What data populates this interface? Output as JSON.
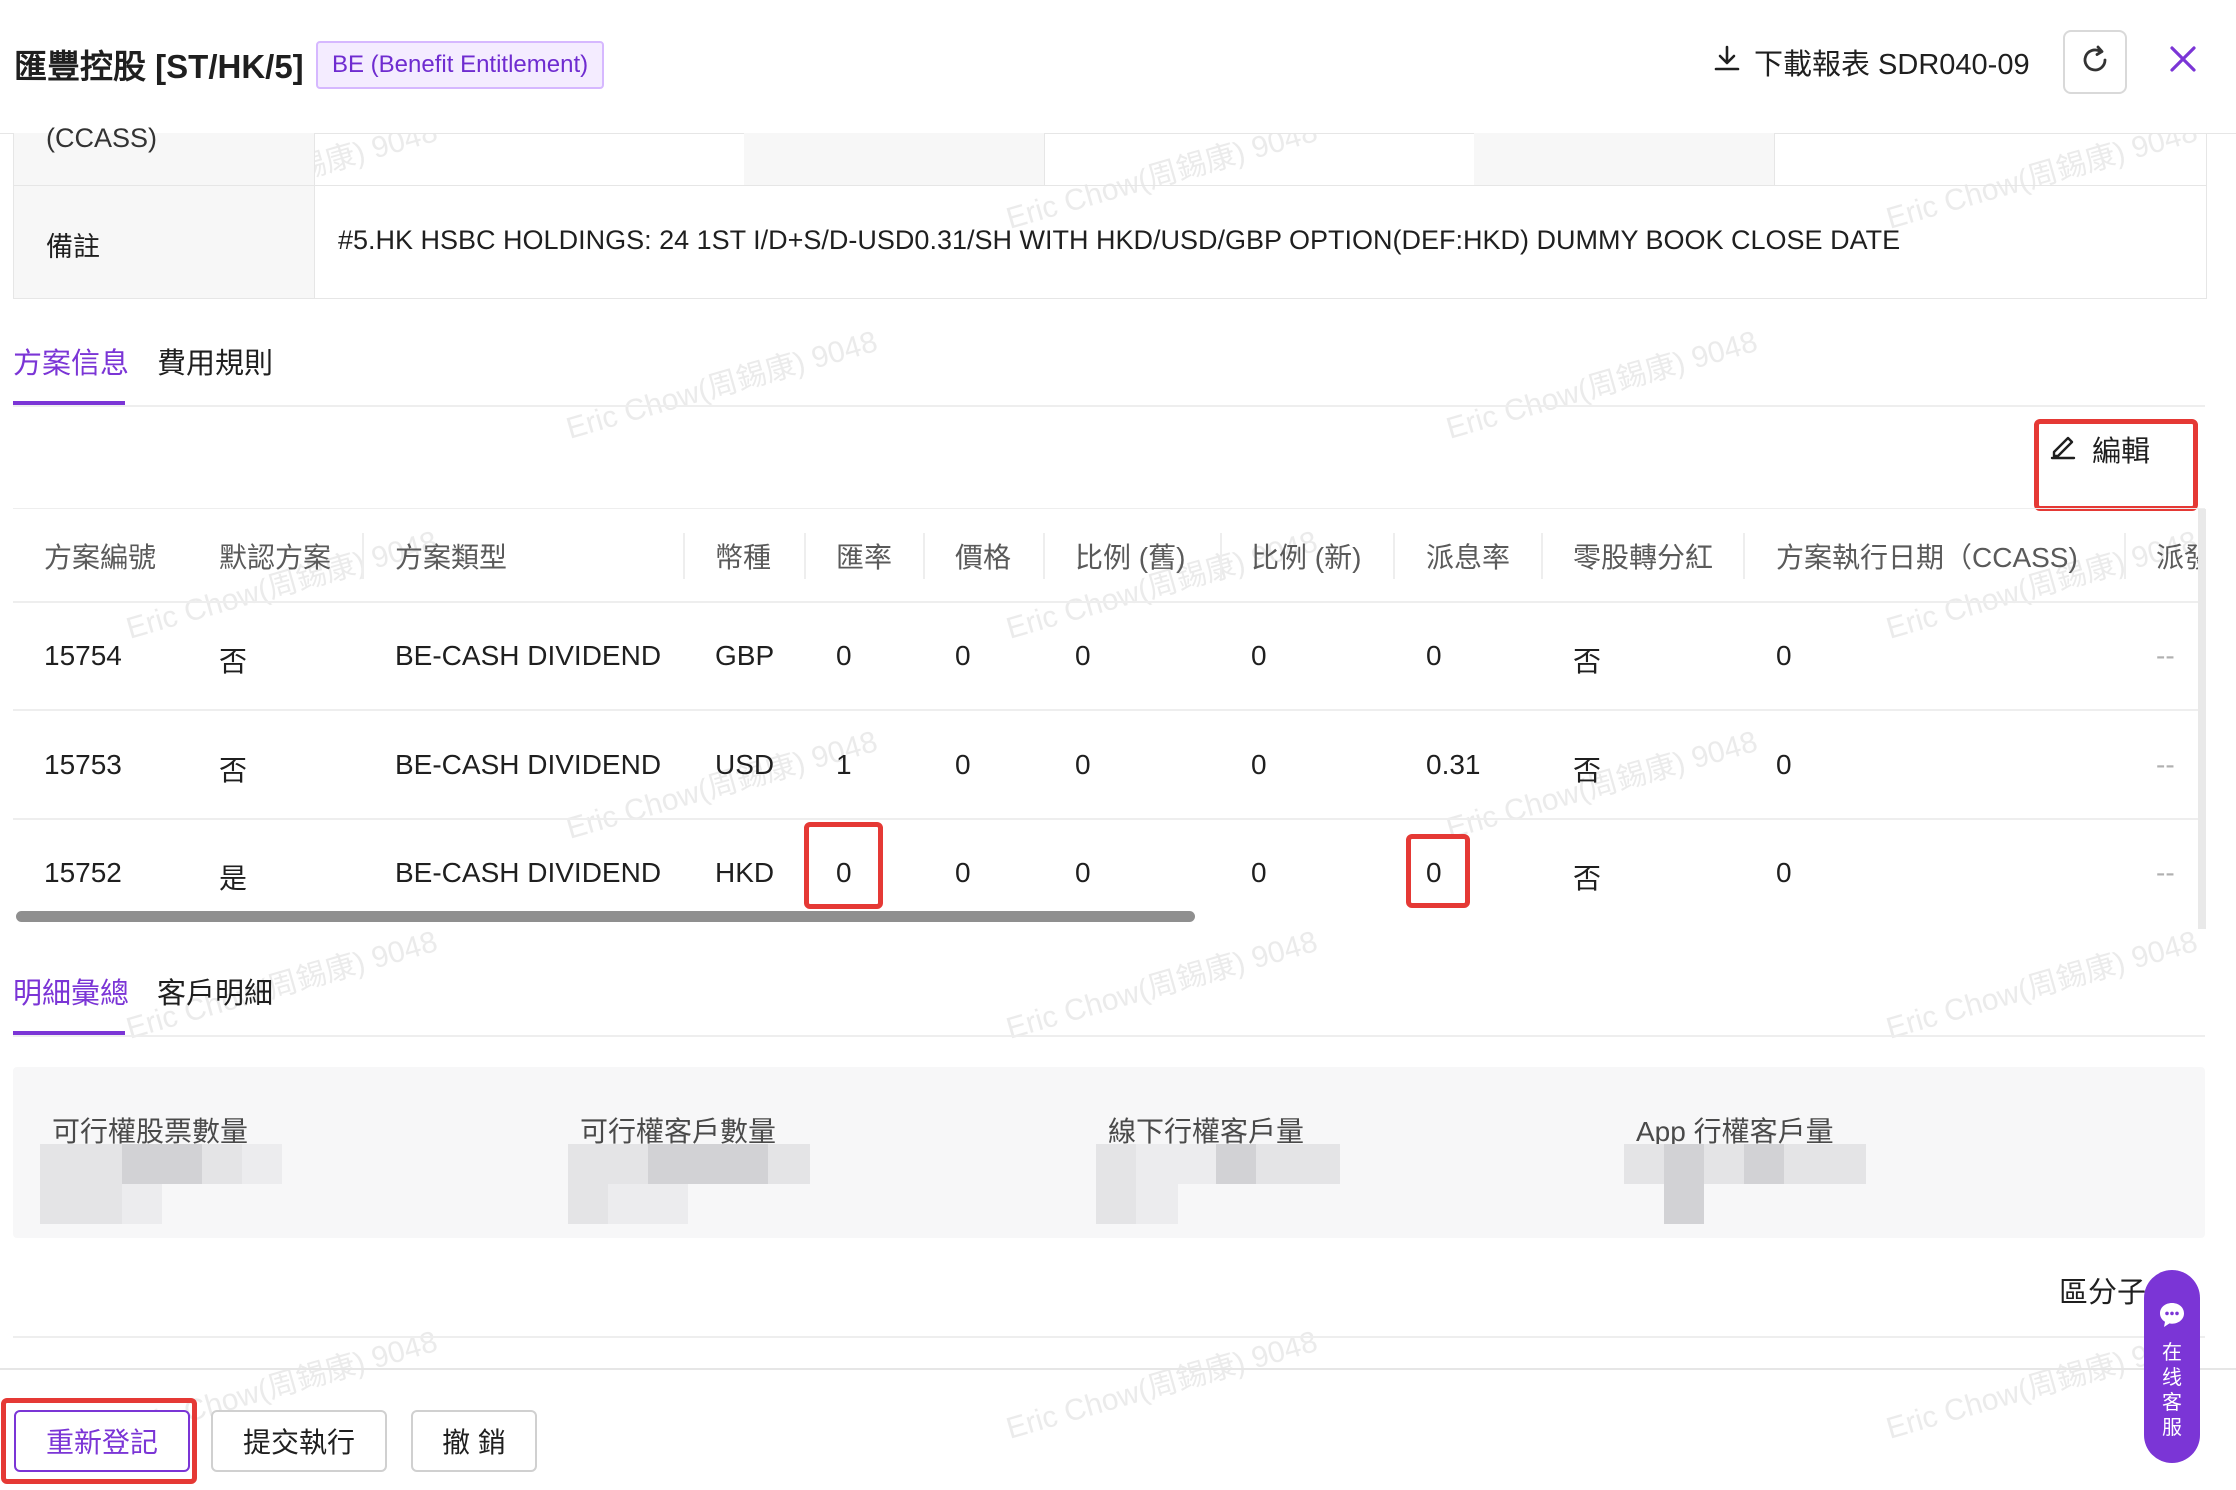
{
  "header": {
    "title": "匯豐控股 [ST/HK/5]",
    "badge": "BE (Benefit Entitlement)",
    "download_label": "下載報表 SDR040-09"
  },
  "info": {
    "ccass_label": "(CCASS)",
    "remark_label": "備註",
    "remark_value": "#5.HK HSBC HOLDINGS: 24 1ST I/D+S/D-USD0.31/SH WITH HKD/USD/GBP OPTION(DEF:HKD) DUMMY BOOK CLOSE DATE"
  },
  "tabs1": [
    "方案信息",
    "費用規則"
  ],
  "edit_label": "編輯",
  "table": {
    "headers": [
      "方案編號",
      "默認方案",
      "方案類型",
      "幣種",
      "匯率",
      "價格",
      "比例 (舊)",
      "比例 (新)",
      "派息率",
      "零股轉分紅",
      "方案執行日期（CCASS)",
      "派發"
    ],
    "rows": [
      [
        "15754",
        "否",
        "BE-CASH DIVIDEND",
        "GBP",
        "0",
        "0",
        "0",
        "0",
        "0",
        "否",
        "0",
        "--"
      ],
      [
        "15753",
        "否",
        "BE-CASH DIVIDEND",
        "USD",
        "1",
        "0",
        "0",
        "0",
        "0.31",
        "否",
        "0",
        "--"
      ],
      [
        "15752",
        "是",
        "BE-CASH DIVIDEND",
        "HKD",
        "0",
        "0",
        "0",
        "0",
        "0",
        "否",
        "0",
        "--"
      ]
    ]
  },
  "tabs2": [
    "明細彙總",
    "客戶明細"
  ],
  "summary": [
    "可行權股票數量",
    "可行權客戶數量",
    "線下行權客戶量",
    "App 行權客戶量"
  ],
  "region_label": "區分子",
  "buttons": {
    "reregister": "重新登記",
    "submit": "提交執行",
    "cancel": "撤 銷"
  },
  "chat": [
    "在",
    "线",
    "客",
    "服"
  ],
  "watermark": "Eric Chow(周錫康) 9048",
  "colors": {
    "accent": "#7b35d6",
    "highlight": "#e53935"
  }
}
